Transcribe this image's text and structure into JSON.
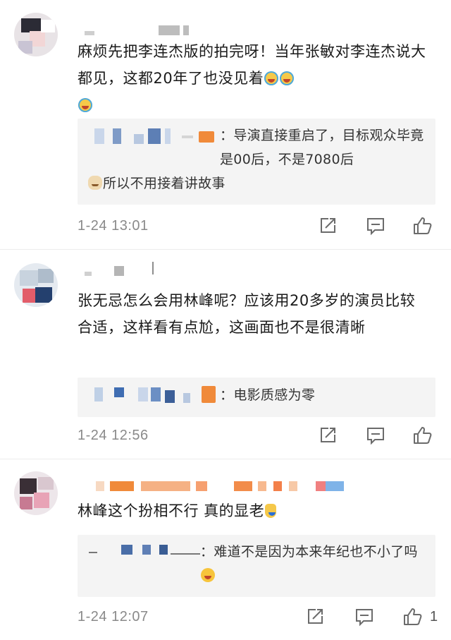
{
  "comments": [
    {
      "text": "麻烦先把李连杰版的拍完呀！当年张敏对李连杰说大都见，这都20年了也没见着",
      "reply": {
        "sep": "：",
        "text_a": "导演直接重启了，目标观众毕竟是00后，不是7080后",
        "text_b": "所以不用接着讲故事"
      },
      "time": "1-24  13:01"
    },
    {
      "text": "张无忌怎么会用林峰呢？应该用20多岁的演员比较合适，这样看有点尬，这画面也不是很清晰",
      "reply": {
        "sep": "：",
        "text_a": "电影质感为零"
      },
      "time": "1-24  12:56"
    },
    {
      "text": "林峰这个扮相不行  真的显老",
      "reply": {
        "sep": "：",
        "text_a": "难道不是因为本来年纪也不小了吗"
      },
      "time": "1-24  12:07",
      "likes": "1"
    }
  ],
  "icons": {
    "share": "share-icon",
    "comment": "comment-icon",
    "like": "thumbs-up-icon",
    "emoji_laugh": "laugh-cry-emoji-icon",
    "emoji_cat": "cat-face-emoji-icon",
    "emoji_grin": "grin-sweat-emoji-icon",
    "emoji_figure": "small-figure-emoji-icon"
  },
  "colors": {
    "timestamp": "#8a8a8a",
    "reply_bg": "#f4f4f4",
    "accent_orange": "#f08a3a"
  }
}
